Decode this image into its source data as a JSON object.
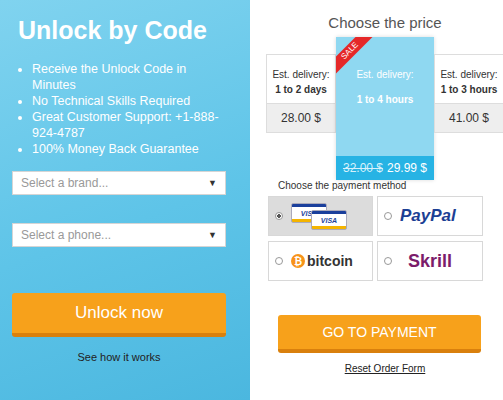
{
  "hero": {
    "title": "Unlock by Code",
    "features": [
      "Receive the Unlock Code in Minutes",
      "No Technical Skills Required",
      "Great Customer Support: +1-888-924-4787",
      "100% Money Back Guarantee"
    ]
  },
  "selects": [
    {
      "placeholder": "Select a brand...",
      "arrow": "▼"
    },
    {
      "placeholder": "Select a phone...",
      "arrow": "▼"
    }
  ],
  "unlock_button": "Unlock now",
  "how_link": "See how it works",
  "pricing": {
    "title": "Choose the price",
    "options": [
      {
        "label": "Est. delivery:",
        "time": "1 to 2 days",
        "price": "28.00 $",
        "featured": false
      },
      {
        "label": "Est. delivery:",
        "time": "1 to 4 hours",
        "old_price": "32.00 $",
        "price": "29.99 $",
        "badge": "SALE",
        "featured": true
      },
      {
        "label": "Est. delivery:",
        "time": "1 to 3 hours",
        "price": "41.00 $",
        "featured": false
      }
    ]
  },
  "payment": {
    "title": "Choose the payment method",
    "methods": [
      {
        "kind": "cards",
        "labels": [
          "VISA",
          "VISA"
        ],
        "selected": true
      },
      {
        "kind": "paypal",
        "label": "PayPal",
        "selected": false
      },
      {
        "kind": "bitcoin",
        "icon": "₿",
        "label": "bitcoin",
        "selected": false
      },
      {
        "kind": "skrill",
        "label": "Skrill",
        "selected": false
      }
    ]
  },
  "pay_button": "GO TO PAYMENT",
  "reset_link": "Reset Order Form"
}
